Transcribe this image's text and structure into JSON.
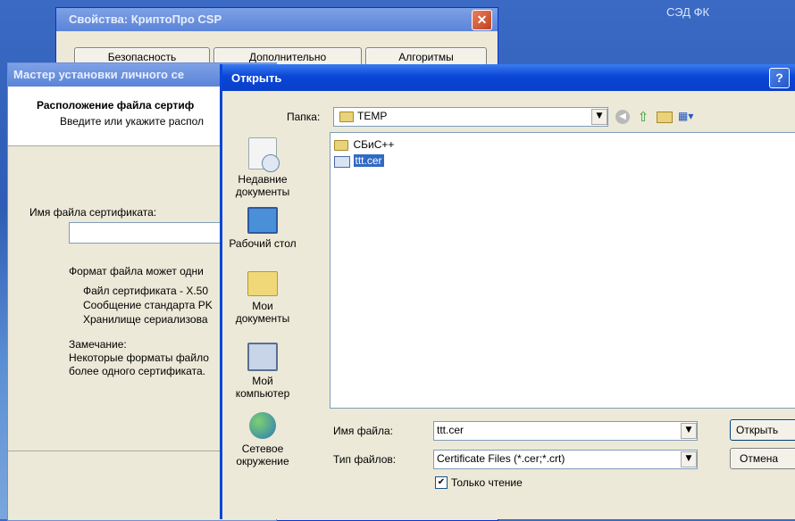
{
  "desktop": {
    "corner_text": "СЭД ФК"
  },
  "props_window": {
    "title": "Свойства: КриптоПро CSP",
    "tabs": [
      "Безопасность",
      "Дополнительно",
      "Алгоритмы"
    ]
  },
  "wizard": {
    "title": "Мастер установки личного се",
    "heading": "Расположение файла сертиф",
    "subheading": "Введите или укажите распол",
    "filename_label": "Имя файла сертификата:",
    "formats_intro": "Формат файла может одни",
    "formats": [
      "Файл сертификата - X.50",
      "Сообщение стандарта PK",
      "Хранилище сериализова"
    ],
    "note_title": "Замечание:",
    "note_lines": [
      "Некоторые форматы файло",
      "более одного сертификата."
    ]
  },
  "open_dialog": {
    "title": "Открыть",
    "folder_label": "Папка:",
    "folder_value": "TEMP",
    "places": [
      {
        "label": "Недавние документы",
        "icon": "recent-documents-icon"
      },
      {
        "label": "Рабочий стол",
        "icon": "desktop-icon"
      },
      {
        "label": "Мои документы",
        "icon": "my-documents-icon"
      },
      {
        "label": "Мой компьютер",
        "icon": "my-computer-icon"
      },
      {
        "label": "Сетевое окружение",
        "icon": "network-icon"
      }
    ],
    "files": [
      {
        "name": "СБиС++",
        "type": "folder"
      },
      {
        "name": "ttt.cer",
        "type": "certificate",
        "selected": true
      }
    ],
    "filename_label": "Имя файла:",
    "filename_value": "ttt.cer",
    "filetype_label": "Тип файлов:",
    "filetype_value": "Certificate Files (*.cer;*.crt)",
    "readonly_label": "Только чтение",
    "readonly_checked": true,
    "open_button": "Открыть",
    "cancel_button": "Отмена"
  },
  "colors": {
    "title_blue": "#0a46d8",
    "selection": "#316ac5",
    "dialog_face": "#ece9d8"
  }
}
